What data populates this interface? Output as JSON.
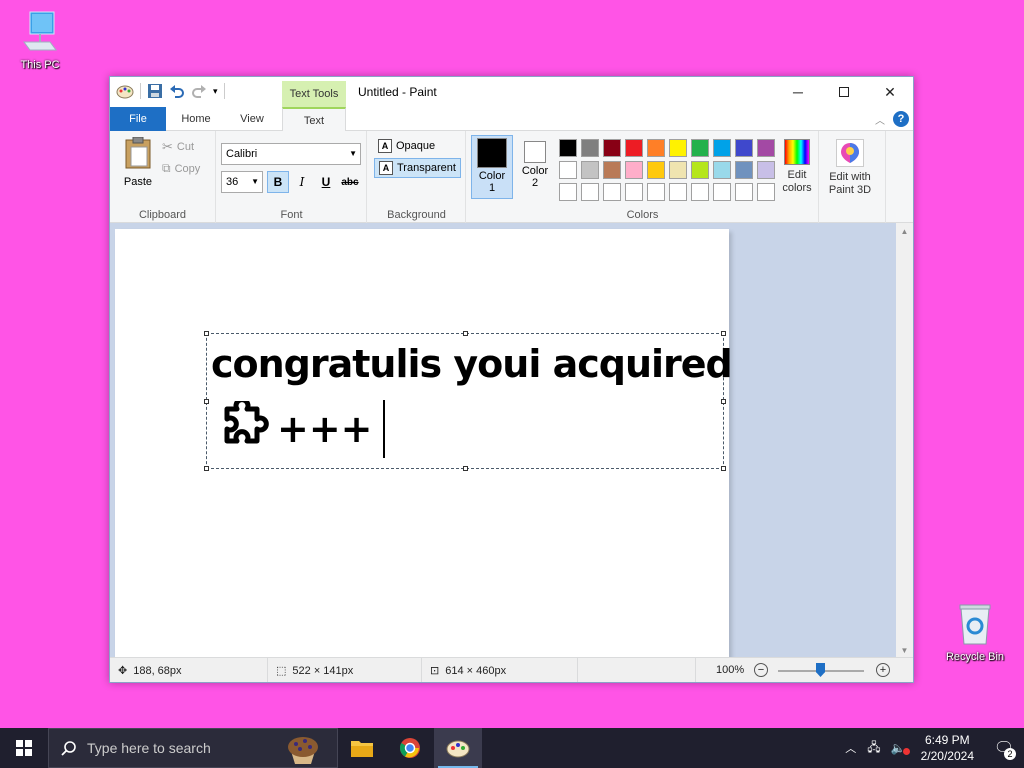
{
  "desktop": {
    "this_pc": "This PC",
    "recycle_bin": "Recycle Bin"
  },
  "window": {
    "title": "Untitled - Paint",
    "context_tab": "Text Tools"
  },
  "tabs": {
    "file": "File",
    "home": "Home",
    "view": "View",
    "text": "Text"
  },
  "clipboard": {
    "paste": "Paste",
    "cut": "Cut",
    "copy": "Copy",
    "label": "Clipboard"
  },
  "font": {
    "family": "Calibri",
    "size": "36",
    "bold": "B",
    "italic": "I",
    "underline": "U",
    "strike": "abc",
    "label": "Font"
  },
  "background": {
    "opaque": "Opaque",
    "transparent": "Transparent",
    "label": "Background"
  },
  "colors": {
    "color1_line1": "Color",
    "color1_line2": "1",
    "color2_line1": "Color",
    "color2_line2": "2",
    "edit_line1": "Edit",
    "edit_line2": "colors",
    "label": "Colors",
    "color1": "#000000",
    "color2": "#ffffff",
    "palette": [
      "#000000",
      "#7f7f7f",
      "#880015",
      "#ed1c24",
      "#ff7f27",
      "#fff200",
      "#22b14c",
      "#00a2e8",
      "#3f48cc",
      "#a349a4",
      "#ffffff",
      "#c3c3c3",
      "#b97a57",
      "#ffaec9",
      "#ffc90e",
      "#efe4b0",
      "#b5e61d",
      "#99d9ea",
      "#7092be",
      "#c8bfe7",
      "#ffffff",
      "#ffffff",
      "#ffffff",
      "#ffffff",
      "#ffffff",
      "#ffffff",
      "#ffffff",
      "#ffffff",
      "#ffffff",
      "#ffffff"
    ]
  },
  "paint3d": {
    "line1": "Edit with",
    "line2": "Paint 3D"
  },
  "canvas": {
    "line1": "congratulis youi acquired",
    "line2": "+++"
  },
  "status": {
    "cursor": "188, 68px",
    "selection": "522 × 141px",
    "image_size": "614 × 460px",
    "zoom": "100%"
  },
  "taskbar": {
    "search_placeholder": "Type here to search",
    "time": "6:49 PM",
    "date": "2/20/2024",
    "notifications": "2"
  }
}
